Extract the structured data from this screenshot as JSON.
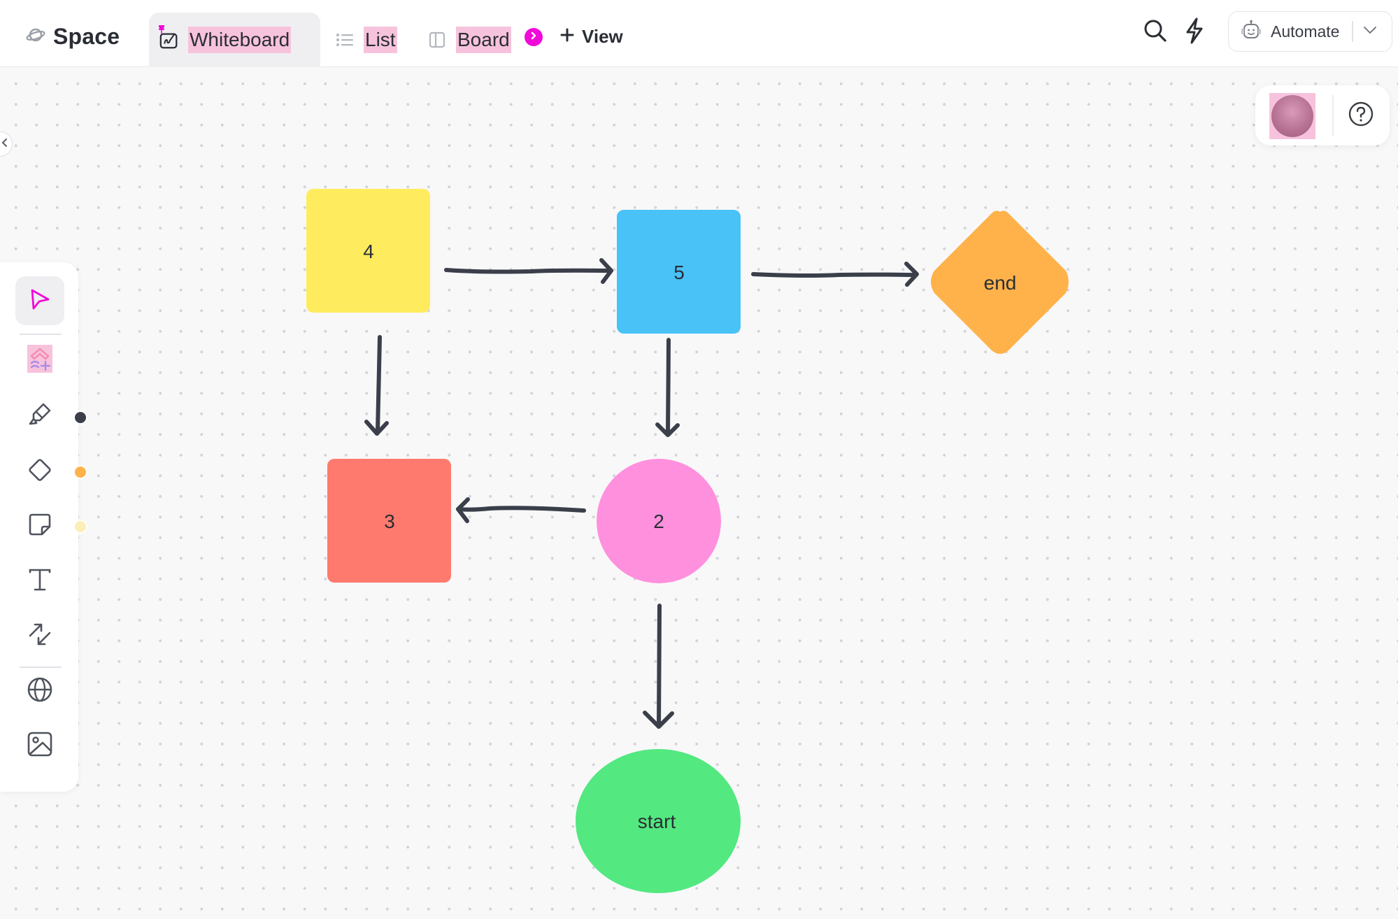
{
  "header": {
    "space_label": "Space",
    "tabs": [
      {
        "label": "Whiteboard",
        "icon": "whiteboard-icon",
        "active": true,
        "pinned": true
      },
      {
        "label": "List",
        "icon": "list-icon",
        "active": false
      },
      {
        "label": "Board",
        "icon": "board-icon",
        "active": false
      }
    ],
    "add_view_label": "View",
    "automate_label": "Automate",
    "icons": [
      "search-icon",
      "lightning-icon",
      "robot-icon",
      "chevron-down-icon"
    ]
  },
  "toolbar": {
    "tools": [
      {
        "name": "select",
        "icon": "cursor-icon",
        "active": true
      },
      {
        "name": "templates",
        "icon": "templates-icon"
      },
      {
        "name": "pen",
        "icon": "pen-icon",
        "swatch": "#3a3f4a"
      },
      {
        "name": "shape",
        "icon": "diamond-shape-icon",
        "swatch": "#ffb24a"
      },
      {
        "name": "sticky-note",
        "icon": "sticky-note-icon",
        "swatch": "#fbeeb8"
      },
      {
        "name": "text",
        "icon": "text-icon"
      },
      {
        "name": "connector",
        "icon": "connector-arrows-icon"
      },
      {
        "name": "embed",
        "icon": "globe-icon"
      },
      {
        "name": "image",
        "icon": "image-icon"
      }
    ],
    "accent": "#f00ad8"
  },
  "presence": {
    "help_icon": "help-circle-icon"
  },
  "diagram": {
    "nodes": [
      {
        "id": "n4",
        "label": "4",
        "shape": "rect",
        "color": "#ffec5e"
      },
      {
        "id": "n5",
        "label": "5",
        "shape": "rect",
        "color": "#49c2f7"
      },
      {
        "id": "end",
        "label": "end",
        "shape": "diamond",
        "color": "#ffb24a"
      },
      {
        "id": "n3",
        "label": "3",
        "shape": "rect",
        "color": "#ff7a6e"
      },
      {
        "id": "n2",
        "label": "2",
        "shape": "circle",
        "color": "#ff90de"
      },
      {
        "id": "start",
        "label": "start",
        "shape": "ellipse",
        "color": "#53e880"
      }
    ],
    "edges": [
      {
        "from": "n4",
        "to": "n5"
      },
      {
        "from": "n5",
        "to": "end"
      },
      {
        "from": "n4",
        "to": "n3"
      },
      {
        "from": "n5",
        "to": "n2"
      },
      {
        "from": "n2",
        "to": "n3"
      },
      {
        "from": "n2",
        "to": "start"
      }
    ],
    "edge_color": "#3a3f4a"
  }
}
